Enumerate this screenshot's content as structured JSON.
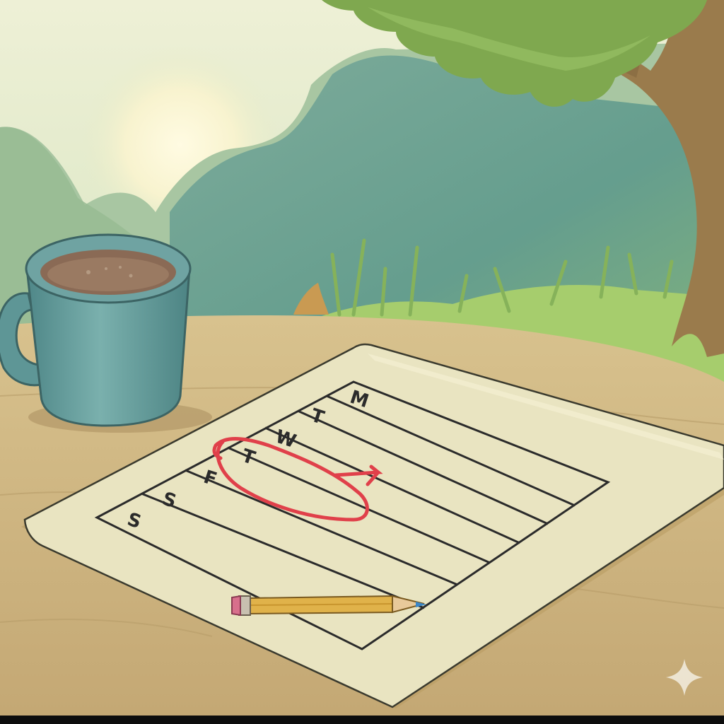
{
  "scene": {
    "weekday_labels": [
      "M",
      "T",
      "W",
      "T",
      "F",
      "S",
      "S"
    ],
    "circled_day_index": 3,
    "colors": {
      "sky_top": "#e9eed0",
      "sun": "#fbf6d6",
      "far_hills": "#a9c7a4",
      "near_hills": "#6f9f93",
      "grass": "#9ec86a",
      "foliage": "#7fa84f",
      "trunk": "#9a7b4c",
      "table": "#cdb583",
      "paper": "#eae6c4",
      "ink": "#2b2b2b",
      "circle_marker": "#e0404a",
      "mug": "#6fa3a2",
      "coffee": "#8a6a55",
      "pencil": "#e0b24a",
      "eraser": "#d86f8c",
      "bottom_bar": "#0d0d0d"
    },
    "icons": [
      "coffee-mug-icon",
      "pencil-icon",
      "sparkle-icon"
    ]
  }
}
